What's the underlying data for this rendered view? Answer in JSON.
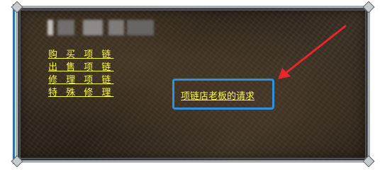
{
  "dialog": {
    "npc_name_obscured": "",
    "menu": [
      {
        "label": "购 买 项 链"
      },
      {
        "label": "出 售 项 链"
      },
      {
        "label": "修 理 项 链"
      },
      {
        "label": "特 殊 修 理"
      }
    ],
    "request_link": "项链店老板的请求"
  },
  "annotation": {
    "highlight_color": "#2f8fe0",
    "arrow_color": "#e8262b"
  },
  "colors": {
    "link_text": "#ffff33",
    "frame": "#a9b0b4"
  }
}
